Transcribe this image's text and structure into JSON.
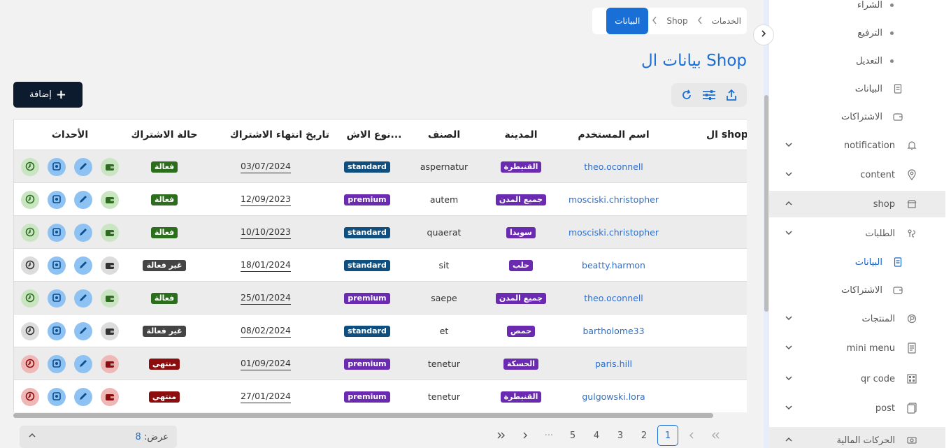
{
  "breadcrumb": {
    "items": [
      "الخدمات",
      "Shop"
    ],
    "active": "البيانات"
  },
  "page_title": "بيانات ال Shop",
  "add_button_label": "إضافة",
  "toolbar": {
    "icons": [
      "refresh-icon",
      "filter-sliders-icon",
      "export-icon"
    ]
  },
  "table": {
    "headers": {
      "shop": "ال shop",
      "username": "اسم المستخدم",
      "city": "المدينة",
      "category": "الصنف",
      "type": "نوع الاش...",
      "expiry": "تاريخ انتهاء الاشتراك",
      "status": "حالة الاشتراك",
      "actions": "الأحداث"
    },
    "rows": [
      {
        "username": "theo.oconnell",
        "city": "القنيطرة",
        "category": "aspernatur",
        "type": "standard",
        "expiry": "03/07/2024",
        "status": "فعالة",
        "status_kind": "active"
      },
      {
        "username": "mosciski.christopher",
        "city": "جميع المدن",
        "category": "autem",
        "type": "premium",
        "expiry": "12/09/2023",
        "status": "فعالة",
        "status_kind": "active"
      },
      {
        "username": "mosciski.christopher",
        "city": "سويدا",
        "category": "quaerat",
        "type": "standard",
        "expiry": "10/10/2023",
        "status": "فعالة",
        "status_kind": "active"
      },
      {
        "username": "beatty.harmon",
        "city": "حلب",
        "category": "sit",
        "type": "standard",
        "expiry": "18/01/2024",
        "status": "غير فعالة",
        "status_kind": "inactive"
      },
      {
        "username": "theo.oconnell",
        "city": "جميع المدن",
        "category": "saepe",
        "type": "premium",
        "expiry": "25/01/2024",
        "status": "فعالة",
        "status_kind": "active"
      },
      {
        "username": "bartholome33",
        "city": "حمص",
        "category": "et",
        "type": "standard",
        "expiry": "08/02/2024",
        "status": "غير فعالة",
        "status_kind": "inactive"
      },
      {
        "username": "paris.hill",
        "city": "الحسكة",
        "category": "tenetur",
        "type": "premium",
        "expiry": "01/09/2024",
        "status": "منتهي",
        "status_kind": "expired"
      },
      {
        "username": "gulgowski.lora",
        "city": "القنيطرة",
        "category": "tenetur",
        "type": "premium",
        "expiry": "27/01/2024",
        "status": "منتهي",
        "status_kind": "expired"
      }
    ]
  },
  "per_page": {
    "label": "عرض:",
    "value": "8"
  },
  "pagination": {
    "pages": [
      "1",
      "2",
      "3",
      "4",
      "5"
    ],
    "ellipsis": "···",
    "current": "1"
  },
  "sidebar": {
    "items": [
      {
        "label": "الشراء",
        "kind": "bullet"
      },
      {
        "label": "الترفيع",
        "kind": "bullet"
      },
      {
        "label": "التعديل",
        "kind": "bullet"
      },
      {
        "label": "البيانات",
        "kind": "sub",
        "icon": "document-icon"
      },
      {
        "label": "الاشتراكات",
        "kind": "sub",
        "icon": "wallet-icon"
      },
      {
        "label": "notification",
        "kind": "group",
        "icon": "bell-icon"
      },
      {
        "label": "content",
        "kind": "group",
        "icon": "location-pin-icon"
      },
      {
        "label": "shop",
        "kind": "group-open",
        "icon": "store-icon"
      },
      {
        "label": "الطلبات",
        "kind": "group",
        "icon": "route-icon"
      },
      {
        "label": "البيانات",
        "kind": "selected",
        "icon": "document-icon"
      },
      {
        "label": "الاشتراكات",
        "kind": "sub",
        "icon": "wallet-icon"
      },
      {
        "label": "المنتجات",
        "kind": "group",
        "icon": "product-icon"
      },
      {
        "label": "mini menu",
        "kind": "group",
        "icon": "menu-doc-icon"
      },
      {
        "label": "qr code",
        "kind": "group",
        "icon": "qr-code-icon"
      },
      {
        "label": "post",
        "kind": "group",
        "icon": "post-icon"
      },
      {
        "label": "الحركات المالية",
        "kind": "section",
        "icon": "money-icon"
      }
    ]
  },
  "colors": {
    "accent": "#1a6fd6",
    "dark_button": "#0d1b2e",
    "active": "#2d6e1e",
    "inactive": "#444444",
    "expired": "#8b0d0d",
    "city_badge": "#6a2bb0",
    "standard_badge": "#0f4f80"
  }
}
